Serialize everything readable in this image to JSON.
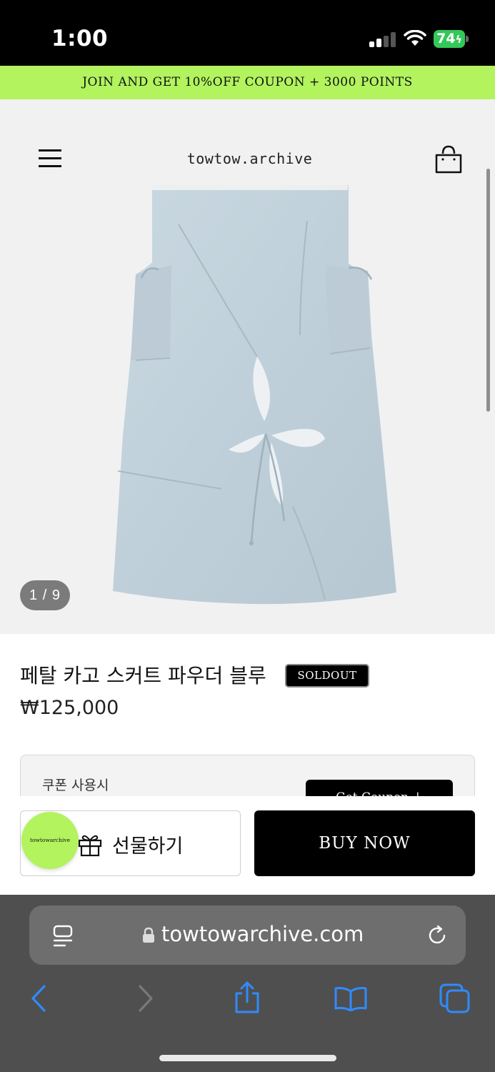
{
  "status_bar": {
    "time": "1:00",
    "battery": "74",
    "icons": [
      "cellular-signal-icon",
      "wifi-icon",
      "battery-charging-icon"
    ]
  },
  "promo_banner": {
    "text": "JOIN AND GET 10%OFF COUPON + 3000 POINTS",
    "color": "#b2f35e"
  },
  "site_header": {
    "logo": "towtow.archive",
    "icons": [
      "hamburger-menu-icon",
      "shopping-bag-icon"
    ]
  },
  "gallery": {
    "counter": "1 / 9",
    "image": "powder-blue-cargo-skirt-photo"
  },
  "product": {
    "name": "페탈 카고 스커트 파우더 블루",
    "badge": "SOLDOUT",
    "price": "₩125,000"
  },
  "coupon": {
    "label": "쿠폰 사용시",
    "button": "Get Coupon ↓"
  },
  "purchase_bar": {
    "gift_label": "선물하기",
    "buy_label": "BUY NOW",
    "brand_bubble": "towtowarchive"
  },
  "browser": {
    "url": "towtowarchive.com",
    "icons": [
      "reader-icon",
      "lock-icon",
      "reload-icon",
      "back-icon",
      "forward-icon",
      "share-icon",
      "bookmarks-icon",
      "tabs-icon"
    ],
    "accent": "#2f8bff"
  }
}
